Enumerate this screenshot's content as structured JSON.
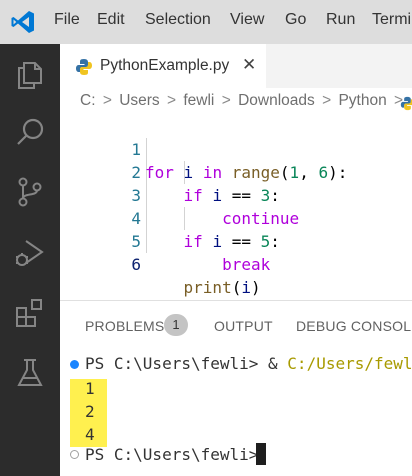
{
  "app": {
    "logo_icon": "vscode-logo-icon",
    "accent": "#0078d4"
  },
  "menu": {
    "file": "File",
    "edit": "Edit",
    "selection": "Selection",
    "view": "View",
    "go": "Go",
    "run": "Run",
    "terminal": "Termi"
  },
  "activity_bar": {
    "icons": [
      "explorer-icon",
      "search-icon",
      "source-control-icon",
      "run-debug-icon",
      "extensions-icon",
      "testing-icon"
    ]
  },
  "editor": {
    "tab": {
      "label": "PythonExample.py",
      "close": "✕",
      "icon": "python-file-icon"
    },
    "breadcrumb": [
      "C:",
      "Users",
      "fewli",
      "Downloads",
      "Python"
    ],
    "breadcrumb_sep": ">",
    "line_numbers": [
      "1",
      "2",
      "3",
      "4",
      "5",
      "6"
    ],
    "code": {
      "l1": {
        "kw1": "for",
        "v1": "i",
        "kw2": "in",
        "fn": "range",
        "p1": "(",
        "n1": "1",
        "c1": ", ",
        "n2": "6",
        "p2": "):"
      },
      "l2": {
        "kw": "if",
        "v": "i",
        "op": " == ",
        "n": "3",
        "p": ":"
      },
      "l3": {
        "kw": "continue"
      },
      "l4": {
        "kw": "if",
        "v": "i",
        "op": " == ",
        "n": "5",
        "p": ":"
      },
      "l5": {
        "kw": "break"
      },
      "l6": {
        "fn": "print",
        "p1": "(",
        "v": "i",
        "p2": ")"
      }
    }
  },
  "panel": {
    "tabs": {
      "problems": "PROBLEMS",
      "output": "OUTPUT",
      "debug_console": "DEBUG CONSOLE"
    },
    "problems_count": "1"
  },
  "terminal": {
    "prompt1": "PS C:\\Users\\fewli> ",
    "amp": "& ",
    "cmd_path": "C:/Users/fewli/",
    "output": [
      "1",
      "2",
      "4"
    ],
    "prompt2": "PS C:\\Users\\fewli> ",
    "highlight_color": "#fff04f",
    "success_dot_color": "#1a85ff"
  }
}
